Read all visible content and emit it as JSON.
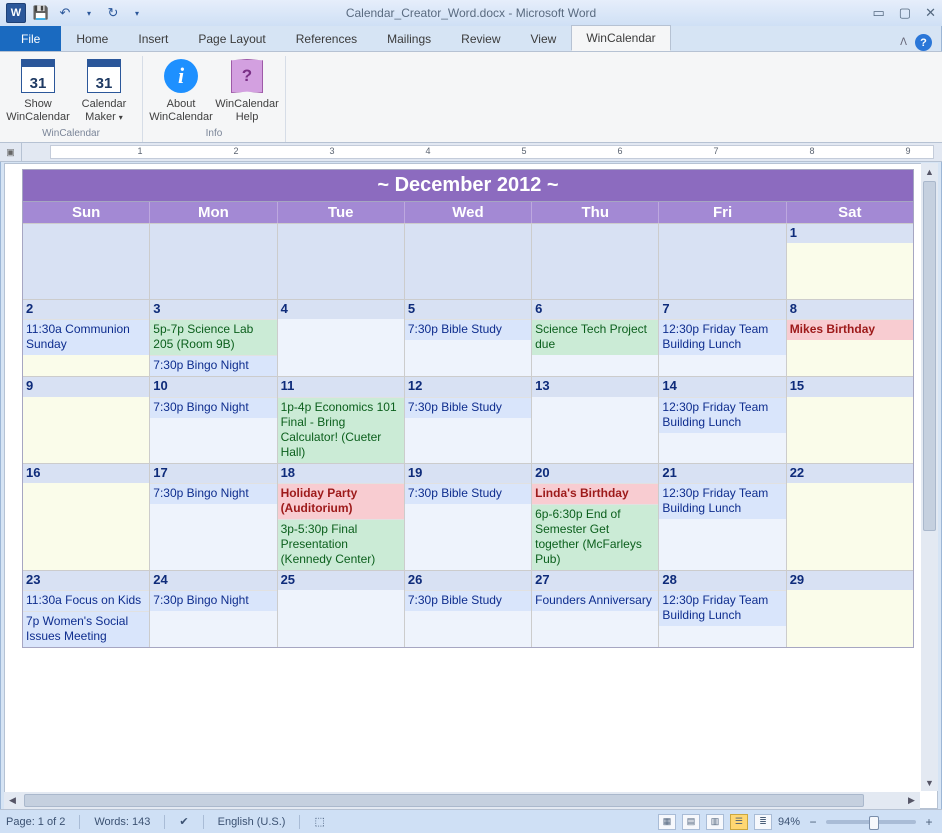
{
  "title_suffix": " - Microsoft Word",
  "doc_filename": "Calendar_Creator_Word.docx",
  "tabs": {
    "file": "File",
    "home": "Home",
    "insert": "Insert",
    "pagelayout": "Page Layout",
    "references": "References",
    "mailings": "Mailings",
    "review": "Review",
    "view": "View",
    "wincalendar": "WinCalendar"
  },
  "ribbon": {
    "group1_label": "WinCalendar",
    "group2_label": "Info",
    "show_label": "Show WinCalendar",
    "maker_label": "Calendar Maker",
    "cal_day": "31",
    "about_label": "About WinCalendar",
    "help_label": "WinCalendar Help"
  },
  "ruler_nums": [
    "1",
    "2",
    "3",
    "4",
    "5",
    "6",
    "7",
    "8",
    "9"
  ],
  "calendar": {
    "title": "~  December 2012  ~",
    "days": [
      "Sun",
      "Mon",
      "Tue",
      "Wed",
      "Thu",
      "Fri",
      "Sat"
    ],
    "rows": [
      [
        {
          "n": "",
          "f": "empty"
        },
        {
          "n": "",
          "f": "empty"
        },
        {
          "n": "",
          "f": "empty"
        },
        {
          "n": "",
          "f": "empty"
        },
        {
          "n": "",
          "f": "empty"
        },
        {
          "n": "",
          "f": "empty"
        },
        {
          "n": "1",
          "f": "lyellow"
        }
      ],
      [
        {
          "n": "2",
          "f": "lyellow",
          "e": [
            {
              "c": "blue",
              "t": "11:30a Communion Sunday"
            }
          ]
        },
        {
          "n": "3",
          "f": "lblue",
          "e": [
            {
              "c": "green",
              "t": "5p-7p Science Lab 205 (Room 9B)"
            },
            {
              "c": "blue",
              "t": "7:30p Bingo Night"
            }
          ]
        },
        {
          "n": "4",
          "f": "lblue"
        },
        {
          "n": "5",
          "f": "lblue",
          "e": [
            {
              "c": "blue",
              "t": "7:30p Bible Study"
            }
          ]
        },
        {
          "n": "6",
          "f": "lblue",
          "e": [
            {
              "c": "green",
              "t": "Science Tech Project due"
            }
          ]
        },
        {
          "n": "7",
          "f": "lblue",
          "e": [
            {
              "c": "blue",
              "t": "12:30p Friday Team Building Lunch"
            }
          ]
        },
        {
          "n": "8",
          "f": "lyellow",
          "e": [
            {
              "c": "pink",
              "t": "Mikes Birthday"
            }
          ]
        }
      ],
      [
        {
          "n": "9",
          "f": "lyellow"
        },
        {
          "n": "10",
          "f": "lblue",
          "e": [
            {
              "c": "blue",
              "t": "7:30p Bingo Night"
            }
          ]
        },
        {
          "n": "11",
          "f": "lblue",
          "e": [
            {
              "c": "green",
              "t": "1p-4p Economics 101 Final - Bring Calculator! (Cueter Hall)"
            }
          ]
        },
        {
          "n": "12",
          "f": "lblue",
          "e": [
            {
              "c": "blue",
              "t": "7:30p Bible Study"
            }
          ]
        },
        {
          "n": "13",
          "f": "lblue"
        },
        {
          "n": "14",
          "f": "lblue",
          "e": [
            {
              "c": "blue",
              "t": "12:30p Friday Team Building Lunch"
            }
          ]
        },
        {
          "n": "15",
          "f": "lyellow"
        }
      ],
      [
        {
          "n": "16",
          "f": "lyellow"
        },
        {
          "n": "17",
          "f": "lblue",
          "e": [
            {
              "c": "blue",
              "t": "7:30p Bingo Night"
            }
          ]
        },
        {
          "n": "18",
          "f": "lblue",
          "e": [
            {
              "c": "pink",
              "t": "Holiday Party (Auditorium)"
            },
            {
              "c": "green",
              "t": "3p-5:30p Final Presentation (Kennedy Center)"
            }
          ]
        },
        {
          "n": "19",
          "f": "lblue",
          "e": [
            {
              "c": "blue",
              "t": "7:30p Bible Study"
            }
          ]
        },
        {
          "n": "20",
          "f": "lblue",
          "e": [
            {
              "c": "pink",
              "t": "Linda's Birthday"
            },
            {
              "c": "green",
              "t": "6p-6:30p End of Semester Get together (McFarleys Pub)"
            }
          ]
        },
        {
          "n": "21",
          "f": "lblue",
          "e": [
            {
              "c": "blue",
              "t": "12:30p Friday Team Building Lunch"
            }
          ]
        },
        {
          "n": "22",
          "f": "lyellow"
        }
      ],
      [
        {
          "n": "23",
          "f": "lyellow",
          "e": [
            {
              "c": "blue",
              "t": "11:30a Focus on Kids"
            },
            {
              "c": "blue",
              "t": "7p Women's Social Issues Meeting"
            }
          ]
        },
        {
          "n": "24",
          "f": "lblue",
          "e": [
            {
              "c": "blue",
              "t": "7:30p Bingo Night"
            }
          ]
        },
        {
          "n": "25",
          "f": "lblue"
        },
        {
          "n": "26",
          "f": "lblue",
          "e": [
            {
              "c": "blue",
              "t": "7:30p Bible Study"
            }
          ]
        },
        {
          "n": "27",
          "f": "lblue",
          "e": [
            {
              "c": "blue",
              "t": "Founders Anniversary"
            }
          ]
        },
        {
          "n": "28",
          "f": "lblue",
          "e": [
            {
              "c": "blue",
              "t": "12:30p Friday Team Building Lunch"
            }
          ]
        },
        {
          "n": "29",
          "f": "lyellow"
        }
      ]
    ]
  },
  "status": {
    "page": "Page: 1 of 2",
    "words": "Words: 143",
    "lang": "English (U.S.)",
    "zoom": "94%"
  }
}
